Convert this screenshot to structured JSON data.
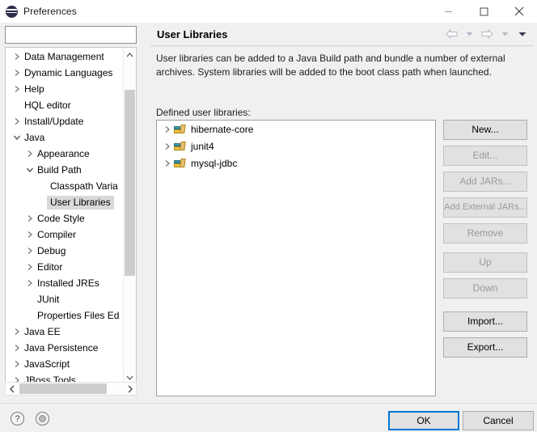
{
  "window": {
    "title": "Preferences",
    "icon": "eclipse-icon",
    "controls": {
      "minimize": "minimize-icon",
      "maximize": "maximize-icon",
      "close": "close-icon"
    }
  },
  "sidebar": {
    "filter": {
      "value": "",
      "placeholder": ""
    },
    "items": [
      {
        "label": "Data Management",
        "indent": 0,
        "state": "collapsed",
        "selected": false
      },
      {
        "label": "Dynamic Languages",
        "indent": 0,
        "state": "collapsed",
        "selected": false
      },
      {
        "label": "Help",
        "indent": 0,
        "state": "collapsed",
        "selected": false
      },
      {
        "label": "HQL editor",
        "indent": 0,
        "state": "leaf",
        "selected": false
      },
      {
        "label": "Install/Update",
        "indent": 0,
        "state": "collapsed",
        "selected": false
      },
      {
        "label": "Java",
        "indent": 0,
        "state": "expanded",
        "selected": false
      },
      {
        "label": "Appearance",
        "indent": 1,
        "state": "collapsed",
        "selected": false
      },
      {
        "label": "Build Path",
        "indent": 1,
        "state": "expanded",
        "selected": false
      },
      {
        "label": "Classpath Varia",
        "indent": 2,
        "state": "leaf",
        "selected": false
      },
      {
        "label": "User Libraries",
        "indent": 2,
        "state": "leaf",
        "selected": true
      },
      {
        "label": "Code Style",
        "indent": 1,
        "state": "collapsed",
        "selected": false
      },
      {
        "label": "Compiler",
        "indent": 1,
        "state": "collapsed",
        "selected": false
      },
      {
        "label": "Debug",
        "indent": 1,
        "state": "collapsed",
        "selected": false
      },
      {
        "label": "Editor",
        "indent": 1,
        "state": "collapsed",
        "selected": false
      },
      {
        "label": "Installed JREs",
        "indent": 1,
        "state": "collapsed",
        "selected": false
      },
      {
        "label": "JUnit",
        "indent": 1,
        "state": "leaf",
        "selected": false
      },
      {
        "label": "Properties Files Ed",
        "indent": 1,
        "state": "leaf",
        "selected": false
      },
      {
        "label": "Java EE",
        "indent": 0,
        "state": "collapsed",
        "selected": false
      },
      {
        "label": "Java Persistence",
        "indent": 0,
        "state": "collapsed",
        "selected": false
      },
      {
        "label": "JavaScript",
        "indent": 0,
        "state": "collapsed",
        "selected": false
      },
      {
        "label": "JBoss Tools",
        "indent": 0,
        "state": "collapsed",
        "selected": false
      }
    ]
  },
  "page": {
    "title": "User Libraries",
    "nav": {
      "back": "back-arrow-icon",
      "back_menu": "chevron-down-icon",
      "forward": "forward-arrow-icon",
      "forward_menu": "chevron-down-icon",
      "view_menu": "chevron-down-icon"
    },
    "description": "User libraries can be added to a Java Build path and bundle a number of external archives. System libraries will be added to the boot class path when launched.",
    "list_label": "Defined user libraries:",
    "libraries": [
      {
        "name": "hibernate-core",
        "icon": "library-icon",
        "state": "collapsed"
      },
      {
        "name": "junit4",
        "icon": "library-icon",
        "state": "collapsed"
      },
      {
        "name": "mysql-jdbc",
        "icon": "library-icon",
        "state": "collapsed"
      }
    ],
    "buttons": [
      {
        "label": "New...",
        "enabled": true,
        "group": 0
      },
      {
        "label": "Edit...",
        "enabled": false,
        "group": 0
      },
      {
        "label": "Add JARs...",
        "enabled": false,
        "group": 0
      },
      {
        "label": "Add External JARs...",
        "enabled": false,
        "group": 0
      },
      {
        "label": "Remove",
        "enabled": false,
        "group": 0
      },
      {
        "label": "Up",
        "enabled": false,
        "group": 1
      },
      {
        "label": "Down",
        "enabled": false,
        "group": 1
      },
      {
        "label": "Import...",
        "enabled": true,
        "group": 2
      },
      {
        "label": "Export...",
        "enabled": true,
        "group": 2
      }
    ]
  },
  "footer": {
    "help_icon": "question-mark-icon",
    "apply_icon": "apply-icon",
    "ok_label": "OK",
    "cancel_label": "Cancel"
  },
  "colors": {
    "accent": "#0078d7",
    "dialog_bg": "#f0f0f0",
    "selection": "#d9d9d9",
    "button_bg": "#e1e1e1",
    "disabled_text": "#9a9a9a"
  }
}
